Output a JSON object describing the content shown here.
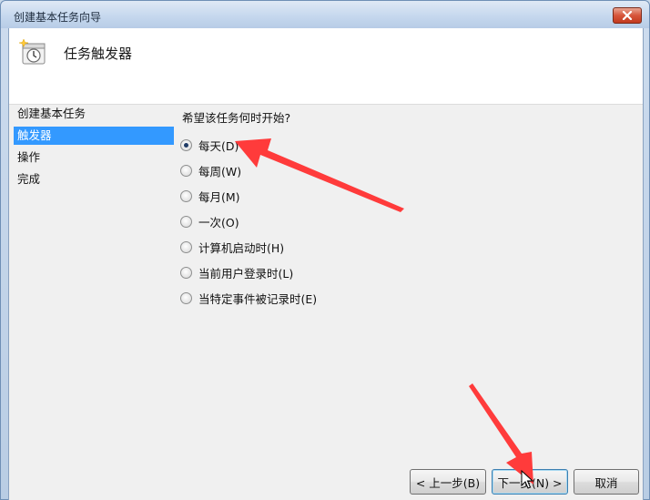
{
  "window": {
    "title": "创建基本任务向导",
    "close_icon": "close-icon"
  },
  "header": {
    "title": "任务触发器",
    "icon": "scheduler-clock-icon"
  },
  "nav": {
    "items": [
      {
        "label": "创建基本任务",
        "selected": false
      },
      {
        "label": "触发器",
        "selected": true
      },
      {
        "label": "操作",
        "selected": false
      },
      {
        "label": "完成",
        "selected": false
      }
    ],
    "selected_color": "#3399ff"
  },
  "main": {
    "question": "希望该任务何时开始?",
    "options": [
      {
        "label": "每天(D)",
        "checked": true
      },
      {
        "label": "每周(W)",
        "checked": false
      },
      {
        "label": "每月(M)",
        "checked": false
      },
      {
        "label": "一次(O)",
        "checked": false
      },
      {
        "label": "计算机启动时(H)",
        "checked": false
      },
      {
        "label": "当前用户登录时(L)",
        "checked": false
      },
      {
        "label": "当特定事件被记录时(E)",
        "checked": false
      }
    ]
  },
  "footer": {
    "back_label": "< 上一步(B)",
    "next_label": "下一步(N) >",
    "cancel_label": "取消"
  },
  "annotations": {
    "arrow_color": "#ff3b3b"
  }
}
